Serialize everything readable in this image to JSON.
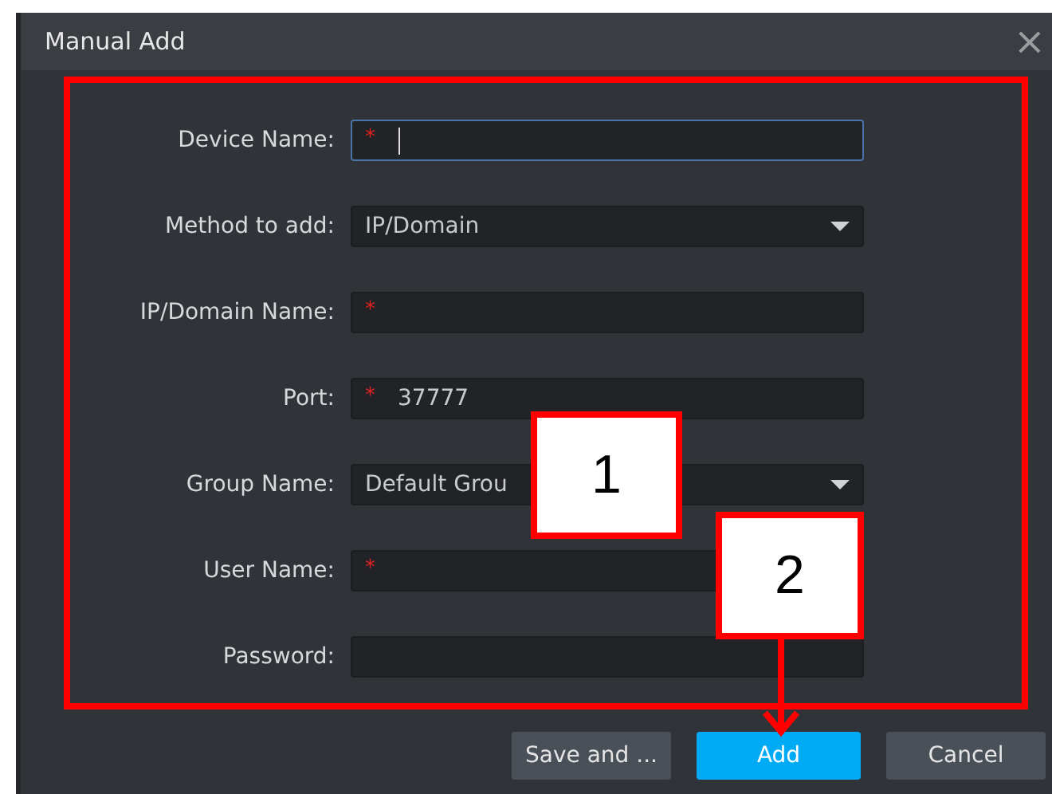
{
  "window": {
    "title": "Manual Add",
    "close": "×"
  },
  "fields": [
    {
      "label": "Device Name:",
      "kind": "text",
      "marker": "*",
      "focused": true
    },
    {
      "label": "Method to add:",
      "kind": "select",
      "value": "IP/Domain",
      "focused": false
    },
    {
      "label": "IP/Domain Name:",
      "kind": "text",
      "marker": "*",
      "focused": false
    },
    {
      "label": "Port:",
      "kind": "text",
      "marker": "*",
      "value": "37777",
      "focused": false
    },
    {
      "label": "Group Name:",
      "kind": "select",
      "value": "Default Grou",
      "focused": false
    },
    {
      "label": "User Name:",
      "kind": "text",
      "marker": "*",
      "focused": false
    },
    {
      "label": "Password:",
      "kind": "text",
      "focused": false
    }
  ],
  "buttons": [
    {
      "label": "Save and ...",
      "kind": "default"
    },
    {
      "label": "Add",
      "kind": "primary"
    },
    {
      "label": "Cancel",
      "kind": "default"
    }
  ],
  "callouts": [
    {
      "label": "1"
    },
    {
      "label": "2",
      "pointer": true
    }
  ]
}
